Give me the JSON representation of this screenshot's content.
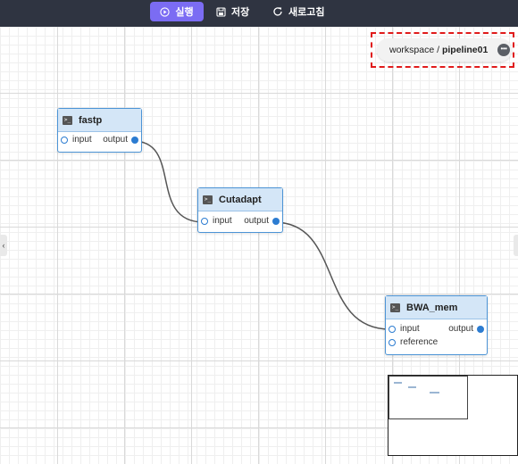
{
  "toolbar": {
    "run_label": "실행",
    "save_label": "저장",
    "refresh_label": "새로고침"
  },
  "breadcrumb": {
    "workspace": "workspace / ",
    "pipeline": "pipeline01",
    "more": "•••"
  },
  "nodes": [
    {
      "title": "fastp",
      "ports_in": [
        "input"
      ],
      "ports_out": [
        "output"
      ]
    },
    {
      "title": "Cutadapt",
      "ports_in": [
        "input"
      ],
      "ports_out": [
        "output"
      ]
    },
    {
      "title": "BWA_mem",
      "ports_in": [
        "input",
        "reference"
      ],
      "ports_out": [
        "output"
      ]
    }
  ],
  "colors": {
    "toolbar_bg": "#2f3441",
    "run_button": "#7b6cf3",
    "node_border": "#4c94d6",
    "node_header": "#d4e6f7",
    "port": "#2c7cd1",
    "edge": "#555555",
    "highlight_box": "#e01b1b"
  },
  "icons": {
    "run": "play-circle-icon",
    "save": "save-icon",
    "refresh": "refresh-icon",
    "node": "terminal-icon",
    "more": "more-horizontal-icon",
    "left_handle": "chevron-left-icon"
  }
}
